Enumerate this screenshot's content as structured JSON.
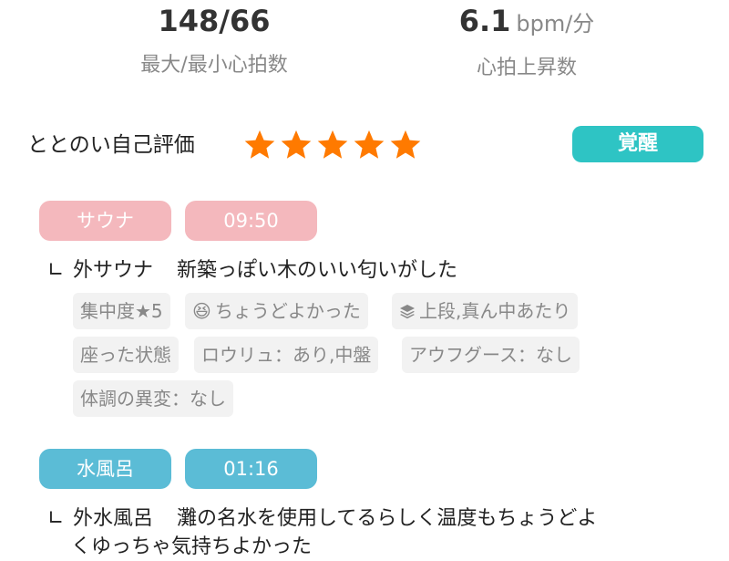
{
  "stats": [
    {
      "value": "148/66",
      "unit": "",
      "label": "最大/最小心拍数"
    },
    {
      "value": "6.1",
      "unit": "bpm/分",
      "label": "心拍上昇数"
    }
  ],
  "evaluation": {
    "label": "ととのい自己評価",
    "stars": 5,
    "max_stars": 5,
    "badge": "覚醒",
    "badge_color": "#2ec4c4"
  },
  "colors": {
    "star": "#ff7a00",
    "sauna_pill": "#f4b8bd",
    "water_pill": "#5bbcd6",
    "tag_bg": "#f2f2f2",
    "tag_text": "#888888"
  },
  "sauna": {
    "category": "サウナ",
    "time": "09:50",
    "spot": "外サウナ",
    "description": "新築っぽい木のいい匂いがした",
    "tags": [
      {
        "icon": "",
        "text": "集中度★5"
      },
      {
        "icon": "😆",
        "text": "ちょうどよかった"
      },
      {
        "icon": "layers-icon",
        "text": "上段,真ん中あたり"
      },
      {
        "icon": "",
        "text": "座った状態"
      },
      {
        "icon": "",
        "text": "ロウリュ：あり,中盤"
      },
      {
        "icon": "",
        "text": "アウフグース：なし"
      },
      {
        "icon": "",
        "text": "体調の異変：なし"
      }
    ]
  },
  "water": {
    "category": "水風呂",
    "time": "01:16",
    "spot": "外水風呂",
    "description_line1": "灘の名水を使用してるらしく温度もちょうどよ",
    "description_line2": "くゆっちゃ気持ちよかった"
  }
}
